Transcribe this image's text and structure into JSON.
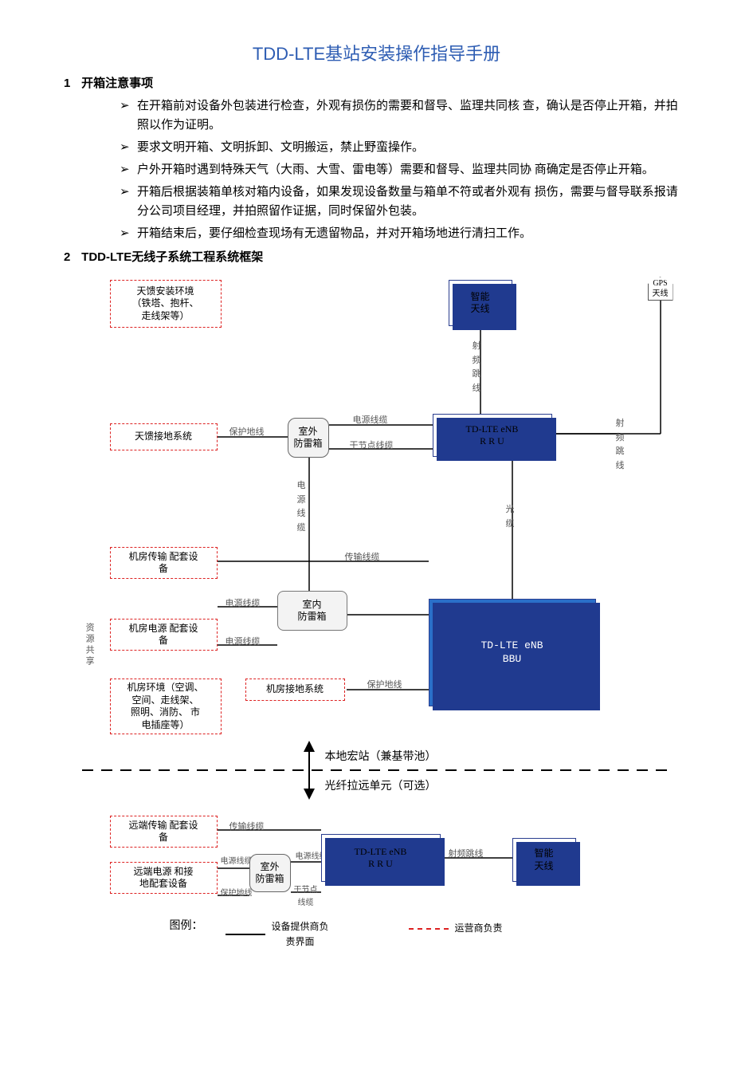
{
  "title": "TDD-LTE基站安装操作指导手册",
  "sections": {
    "s1": {
      "num": "1",
      "head": "开箱注意事项"
    },
    "s2": {
      "num": "2",
      "head": "TDD-LTE无线子系统工程系统框架"
    }
  },
  "bullets": [
    "在开箱前对设备外包装进行检查，外观有损伤的需要和督导、监理共同核  查，确认是否停止开箱，并拍照以作为证明。",
    "要求文明开箱、文明拆卸、文明搬运，禁止野蛮操作。",
    "户外开箱时遇到特殊天气（大雨、大雪、雷电等）需要和督导、监理共同协  商确定是否停止开箱。",
    "开箱后根据装箱单核对箱内设备，如果发现设备数量与箱单不符或者外观有  损伤，需要与督导联系报请分公司项目经理，并拍照留作证据，同时保留外包装。",
    "开箱结束后，要仔细检查现场有无遗留物品，并对开箱场地进行清扫工作。"
  ],
  "diagram": {
    "nodes": {
      "antenna_env": "天馈安装环境\n（铁塔、抱杆、\n走线架等）",
      "smart_ant1": "智能\n天线",
      "gps": "GPS\n天线",
      "ground_sys": "天馈接地系统",
      "outdoor_spd1": "室外\n防雷箱",
      "rru1": "TD-LTE eNB\nR R U",
      "trans_room": "机房传输 配套设\n备",
      "indoor_spd": "室内\n防雷箱",
      "power_room": "机房电源 配套设\n备",
      "bbu": "TD-LTE eNB\nBBU",
      "room_env": "机房环境（空调、\n空间、走线架、\n照明、消防、  市\n电插座等）",
      "room_ground": "机房接地系统",
      "remote_trans": "远端传输 配套设\n备",
      "remote_power": "远端电源  和接\n地配套设备",
      "outdoor_spd2": "室外\n防雷箱",
      "rru2": "TD-LTE eNB\nR R U",
      "smart_ant2": "智能\n天线"
    },
    "edges": {
      "rf_jumper_v": "射\n频\n跳\n线",
      "power_cable": "电源线缆",
      "protect_gnd": "保护地线",
      "dry_contact": "干节点线缆",
      "rf_jumper2": "射\n频\n跳\n线",
      "pwr_vert": "电\n源\n线\n缆",
      "optical": "光\n缆",
      "trans_cable": "传输线缆",
      "rf_jumper_h": "射频跳线",
      "dry_contact2": "干节点\n线缆"
    },
    "vside_label": "资源共享",
    "split_top": "本地宏站（兼基带池）",
    "split_bot": "光纤拉远单元（可选）",
    "legend_head": "图例：",
    "legend_a": "设备提供商负\n责界面",
    "legend_b": "运营商负责"
  }
}
